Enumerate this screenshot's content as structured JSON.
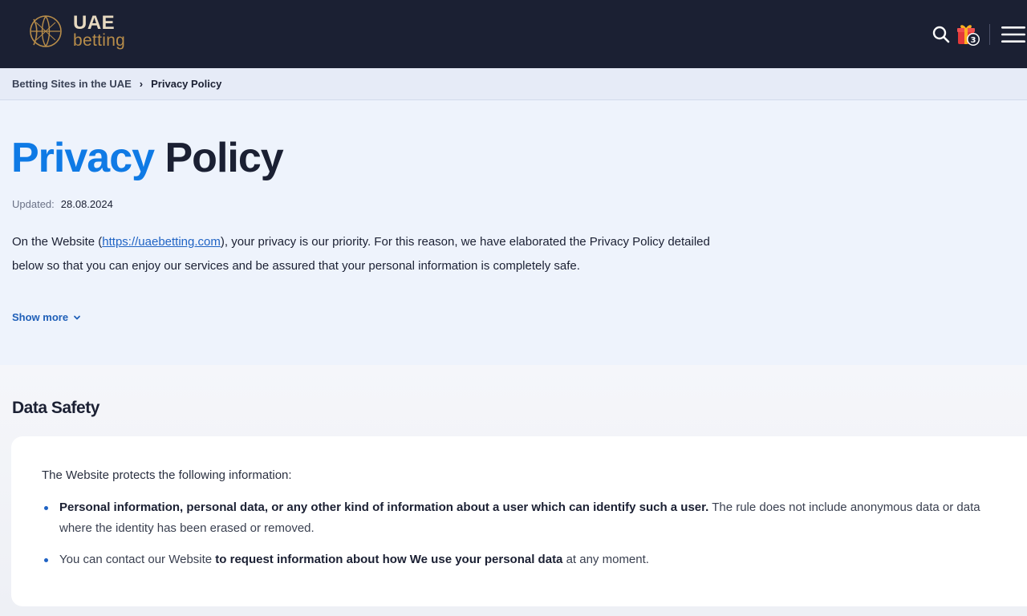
{
  "header": {
    "logo_top": "UAE",
    "logo_bottom": "betting",
    "icons": [
      "logo-icon",
      "search-icon",
      "gift-icon",
      "menu-icon"
    ],
    "gift_badge": "3",
    "colors": {
      "bg": "#1b2033",
      "logo_gold": "#b88d4a"
    }
  },
  "breadcrumb": {
    "home": "Betting Sites in the UAE",
    "separator": "›",
    "current": "Privacy Policy"
  },
  "hero": {
    "title_accent": "Privacy",
    "title_rest": "Policy",
    "updated_label": "Updated:",
    "updated_date": "28.08.2024",
    "intro_prefix": "On the Website (",
    "intro_link": "https://uaebetting.com",
    "intro_suffix": "), your privacy is our priority. For this reason, we have elaborated the Privacy Policy detailed below so that you can enjoy our services and be assured that your personal information is completely safe.",
    "show_more": "Show more",
    "colors": {
      "accent": "#0f7ae5",
      "link": "#1f63c4"
    }
  },
  "data_safety": {
    "title": "Data Safety",
    "lead": "The Website protects the following information:",
    "bullet1_bold": "Personal information, personal data, or any other kind of information about a user which can identify such a user.",
    "bullet1_rest": " The rule does not include anonymous data or data where the identity has been erased or removed.",
    "bullet2_pre": "You can contact our Website ",
    "bullet2_bold": "to request information about how We use your personal data",
    "bullet2_post": " at any moment."
  }
}
